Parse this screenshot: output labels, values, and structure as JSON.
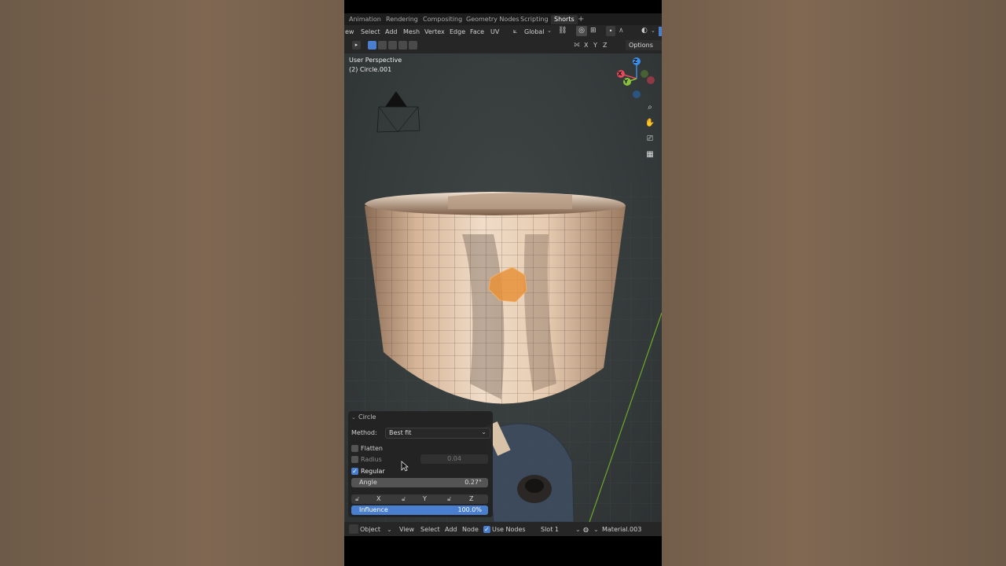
{
  "workspace_tabs": [
    "Animation",
    "Rendering",
    "Compositing",
    "Geometry Nodes",
    "Scripting",
    "Shorts"
  ],
  "workspace_add": "+",
  "menu": {
    "items": [
      "ew",
      "Select",
      "Add",
      "Mesh",
      "Vertex",
      "Edge",
      "Face",
      "UV"
    ],
    "transform_orientation": "Global"
  },
  "header_tools": {
    "axes": [
      "X",
      "Y",
      "Z"
    ],
    "options_label": "Options"
  },
  "viewport": {
    "view_name": "User Perspective",
    "object_name": "(2) Circle.001",
    "gizmo_axes": [
      "Z",
      "Y",
      "X"
    ]
  },
  "operator_panel": {
    "title": "Circle",
    "method_label": "Method:",
    "method_value": "Best fit",
    "flatten_label": "Flatten",
    "flatten_checked": false,
    "radius_label": "Radius",
    "radius_value": "0.04",
    "radius_checked": false,
    "regular_label": "Regular",
    "regular_checked": true,
    "angle_label": "Angle",
    "angle_value": "0.27°",
    "lock_axes": [
      "X",
      "Y",
      "Z"
    ],
    "influence_label": "Influence",
    "influence_value": "100.0%",
    "influence_fraction": 1.0
  },
  "bottom_bar": {
    "mode": "Object",
    "items": [
      "View",
      "Select",
      "Add",
      "Node"
    ],
    "use_nodes_label": "Use Nodes",
    "use_nodes_checked": true,
    "slot": "Slot 1",
    "material": "Material.003"
  },
  "colors": {
    "accent_blue": "#4a7fd0",
    "axis_x": "#e04a5a",
    "axis_y": "#8ac43a",
    "axis_z": "#3a8ee6",
    "mesh_skin": "#c8a585",
    "selected_face": "#e8923a",
    "grid_y_axis": "#6ea82c"
  }
}
